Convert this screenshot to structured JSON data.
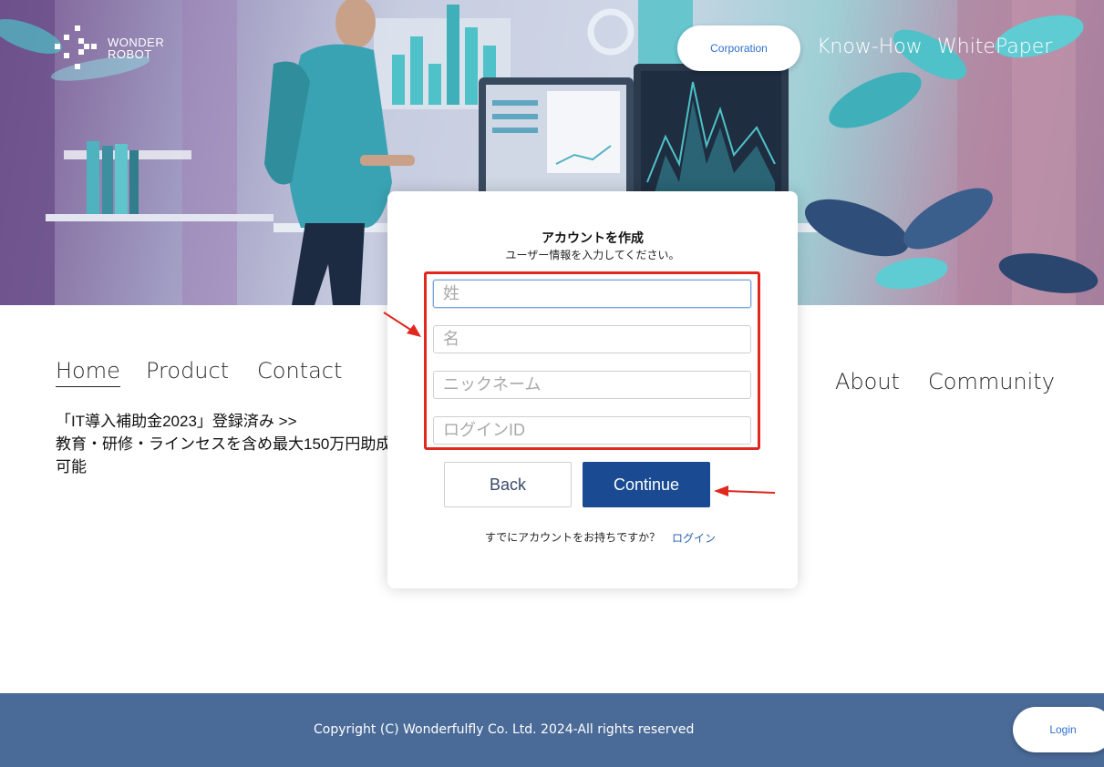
{
  "brand": {
    "line1": "WONDER",
    "line2": "ROBOT",
    "logo_icon": "wonder-robot-logo"
  },
  "header": {
    "corporation_label": "Corporation",
    "knowhow_label": "Know-How",
    "whitepaper_label": "WhitePaper"
  },
  "nav": {
    "home": "Home",
    "product": "Product",
    "contact": "Contact",
    "about": "About",
    "community": "Community"
  },
  "promo": {
    "line1": "「IT導入補助金2023」登録済み >>",
    "line2": "教育・研修・ラインセスを含め最大150万円助成可能"
  },
  "signup": {
    "title": "アカウントを作成",
    "subtitle": "ユーザー情報を入力してください。",
    "last_name_placeholder": "姓",
    "first_name_placeholder": "名",
    "nickname_placeholder": "ニックネーム",
    "login_id_placeholder": "ログインID",
    "back_label": "Back",
    "continue_label": "Continue",
    "have_account_text": "すでにアカウントをお持ちですか？",
    "login_link_label": "ログイン"
  },
  "footer": {
    "copyright": "Copyright (C) Wonderfulfly Co. Ltd. 2024-All rights reserved",
    "login_label": "Login"
  },
  "colors": {
    "continue_button": "#1a4a92",
    "footer_bg": "#4a6a98",
    "highlight_red": "#e0281e",
    "link_blue": "#2f6fd0"
  }
}
